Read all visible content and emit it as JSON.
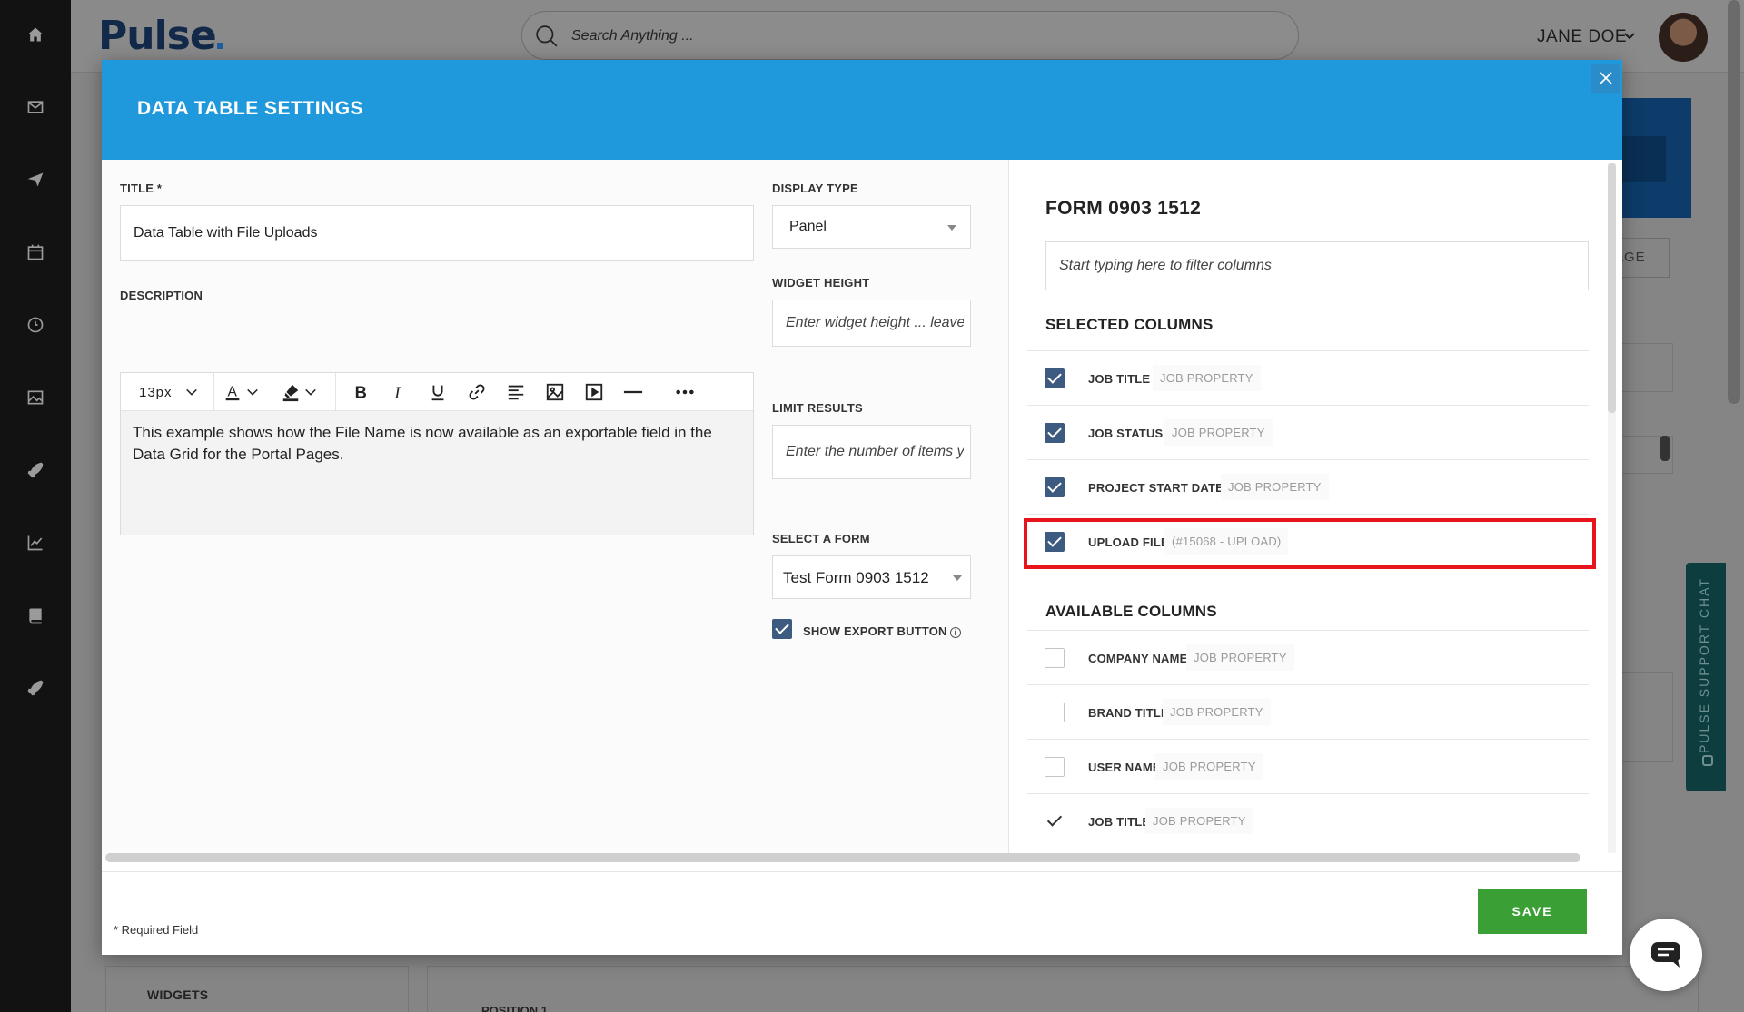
{
  "app": {
    "logo": "Pulse",
    "search_placeholder": "Search Anything ...",
    "user_name": "JANE DOE",
    "bg_page_button": "AGE",
    "bg_widgets": "WIDGETS",
    "bg_position": "POSITION 1",
    "support_chat": "PULSE SUPPORT CHAT"
  },
  "sidebar": {
    "icons": [
      "home-icon",
      "mail-icon",
      "send-icon",
      "calendar-icon",
      "clock-icon",
      "image-icon",
      "rocket-icon",
      "chart-icon",
      "book-icon",
      "rocket-icon-2"
    ]
  },
  "modal": {
    "title": "DATA TABLE SETTINGS",
    "title_label": "TITLE *",
    "title_value": "Data Table with File Uploads",
    "description_label": "DESCRIPTION",
    "font_size": "13px",
    "description_text": "This example shows how the File Name is now available as an exportable field in the Data Grid for the Portal Pages.",
    "display_type_label": "DISPLAY TYPE",
    "display_type_value": "Panel",
    "widget_height_label": "WIDGET HEIGHT",
    "widget_height_placeholder": "Enter widget height ... leave b",
    "limit_results_label": "LIMIT RESULTS",
    "limit_results_placeholder": "Enter the number of items yo",
    "select_form_label": "SELECT A FORM",
    "select_form_value": "Test Form 0903 1512",
    "show_export_label": "SHOW EXPORT BUTTON",
    "required_note": "* Required Field",
    "save_label": "SAVE"
  },
  "columns_panel": {
    "form_title": "FORM 0903 1512",
    "filter_placeholder": "Start typing here to filter columns",
    "selected_title": "SELECTED COLUMNS",
    "available_title": "AVAILABLE COLUMNS",
    "selected": [
      {
        "name": "JOB TITLE",
        "property": "JOB PROPERTY",
        "checked": true
      },
      {
        "name": "JOB STATUS",
        "property": "JOB PROPERTY",
        "checked": true
      },
      {
        "name": "PROJECT START DATE",
        "property": "JOB PROPERTY",
        "checked": true
      },
      {
        "name": "UPLOAD FILE",
        "property": "(#15068 - UPLOAD)",
        "checked": true
      }
    ],
    "available": [
      {
        "name": "COMPANY NAME",
        "property": "JOB PROPERTY",
        "checked": false
      },
      {
        "name": "BRAND TITLE",
        "property": "JOB PROPERTY",
        "checked": false
      },
      {
        "name": "USER NAME",
        "property": "JOB PROPERTY",
        "checked": false
      },
      {
        "name": "JOB TITLE",
        "property": "JOB PROPERTY",
        "checked": true
      }
    ]
  }
}
